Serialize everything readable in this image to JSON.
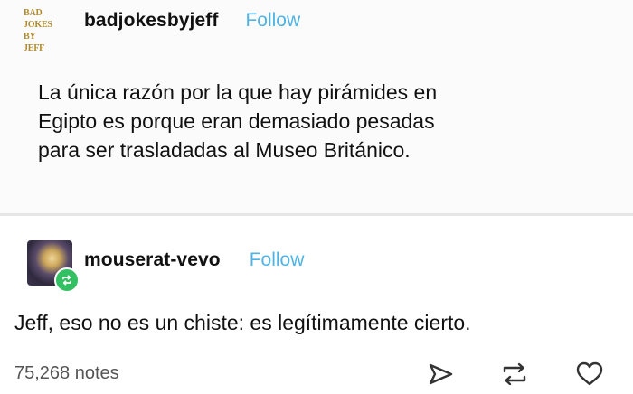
{
  "post1": {
    "avatar_text": [
      "BAD",
      "JOKES",
      "BY JEFF"
    ],
    "username": "badjokesbyjeff",
    "follow_label": "Follow",
    "body_lines": [
      "La única razón por la que hay pirámides en",
      "Egipto es porque eran demasiado pesadas",
      "para ser trasladadas al Museo Británico."
    ]
  },
  "post2": {
    "username": "mouserat-vevo",
    "follow_label": "Follow",
    "body": "Jeff, eso no es un chiste: es legítimamente cierto.",
    "notes": "75,268 notes"
  },
  "colors": {
    "follow_blue": "#4fb3e4",
    "reblog_green": "#33c062",
    "logo_gold": "#b08a2e"
  },
  "icons": {
    "share": "share-icon",
    "reblog": "reblog-icon",
    "like": "heart-icon"
  }
}
